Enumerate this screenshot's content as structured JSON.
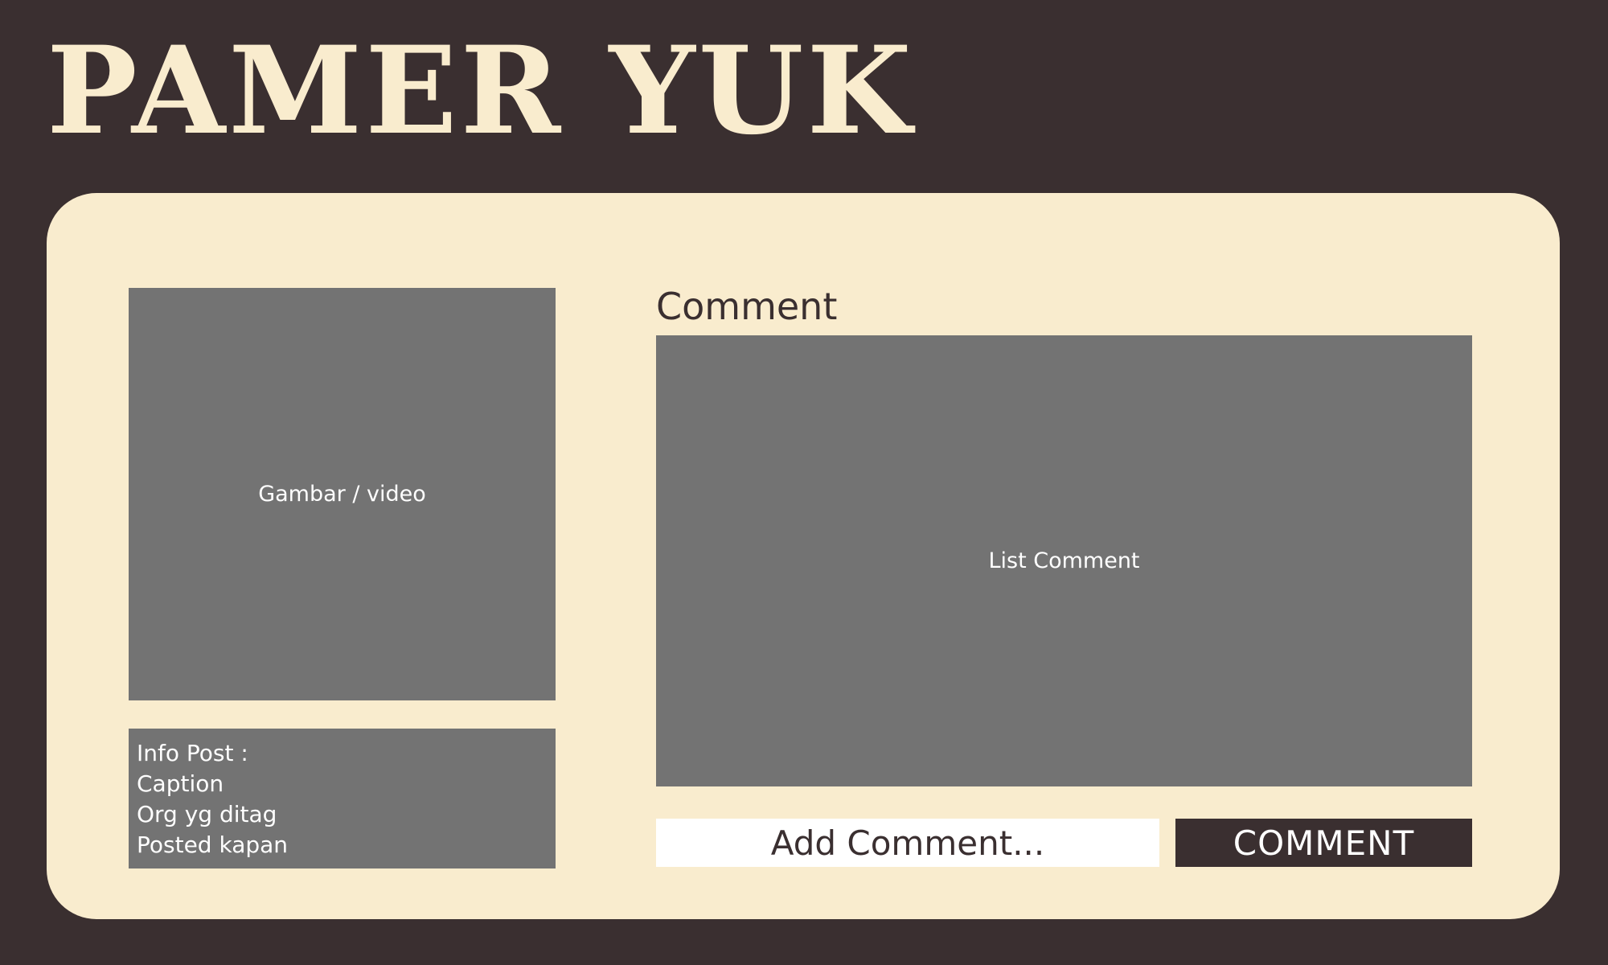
{
  "app": {
    "title": "PAMER YUK"
  },
  "post": {
    "media_placeholder": "Gambar / video",
    "info_lines": [
      "Info Post :",
      "Caption",
      "Org yg ditag",
      "Posted kapan"
    ]
  },
  "comments": {
    "heading": "Comment",
    "list_placeholder": "List Comment",
    "input_placeholder": "Add Comment...",
    "submit_label": "COMMENT"
  },
  "colors": {
    "background": "#3a2f30",
    "card": "#f9ecce",
    "placeholder_box": "#737373",
    "input_bg": "#ffffff",
    "button_bg": "#3a2f30"
  }
}
